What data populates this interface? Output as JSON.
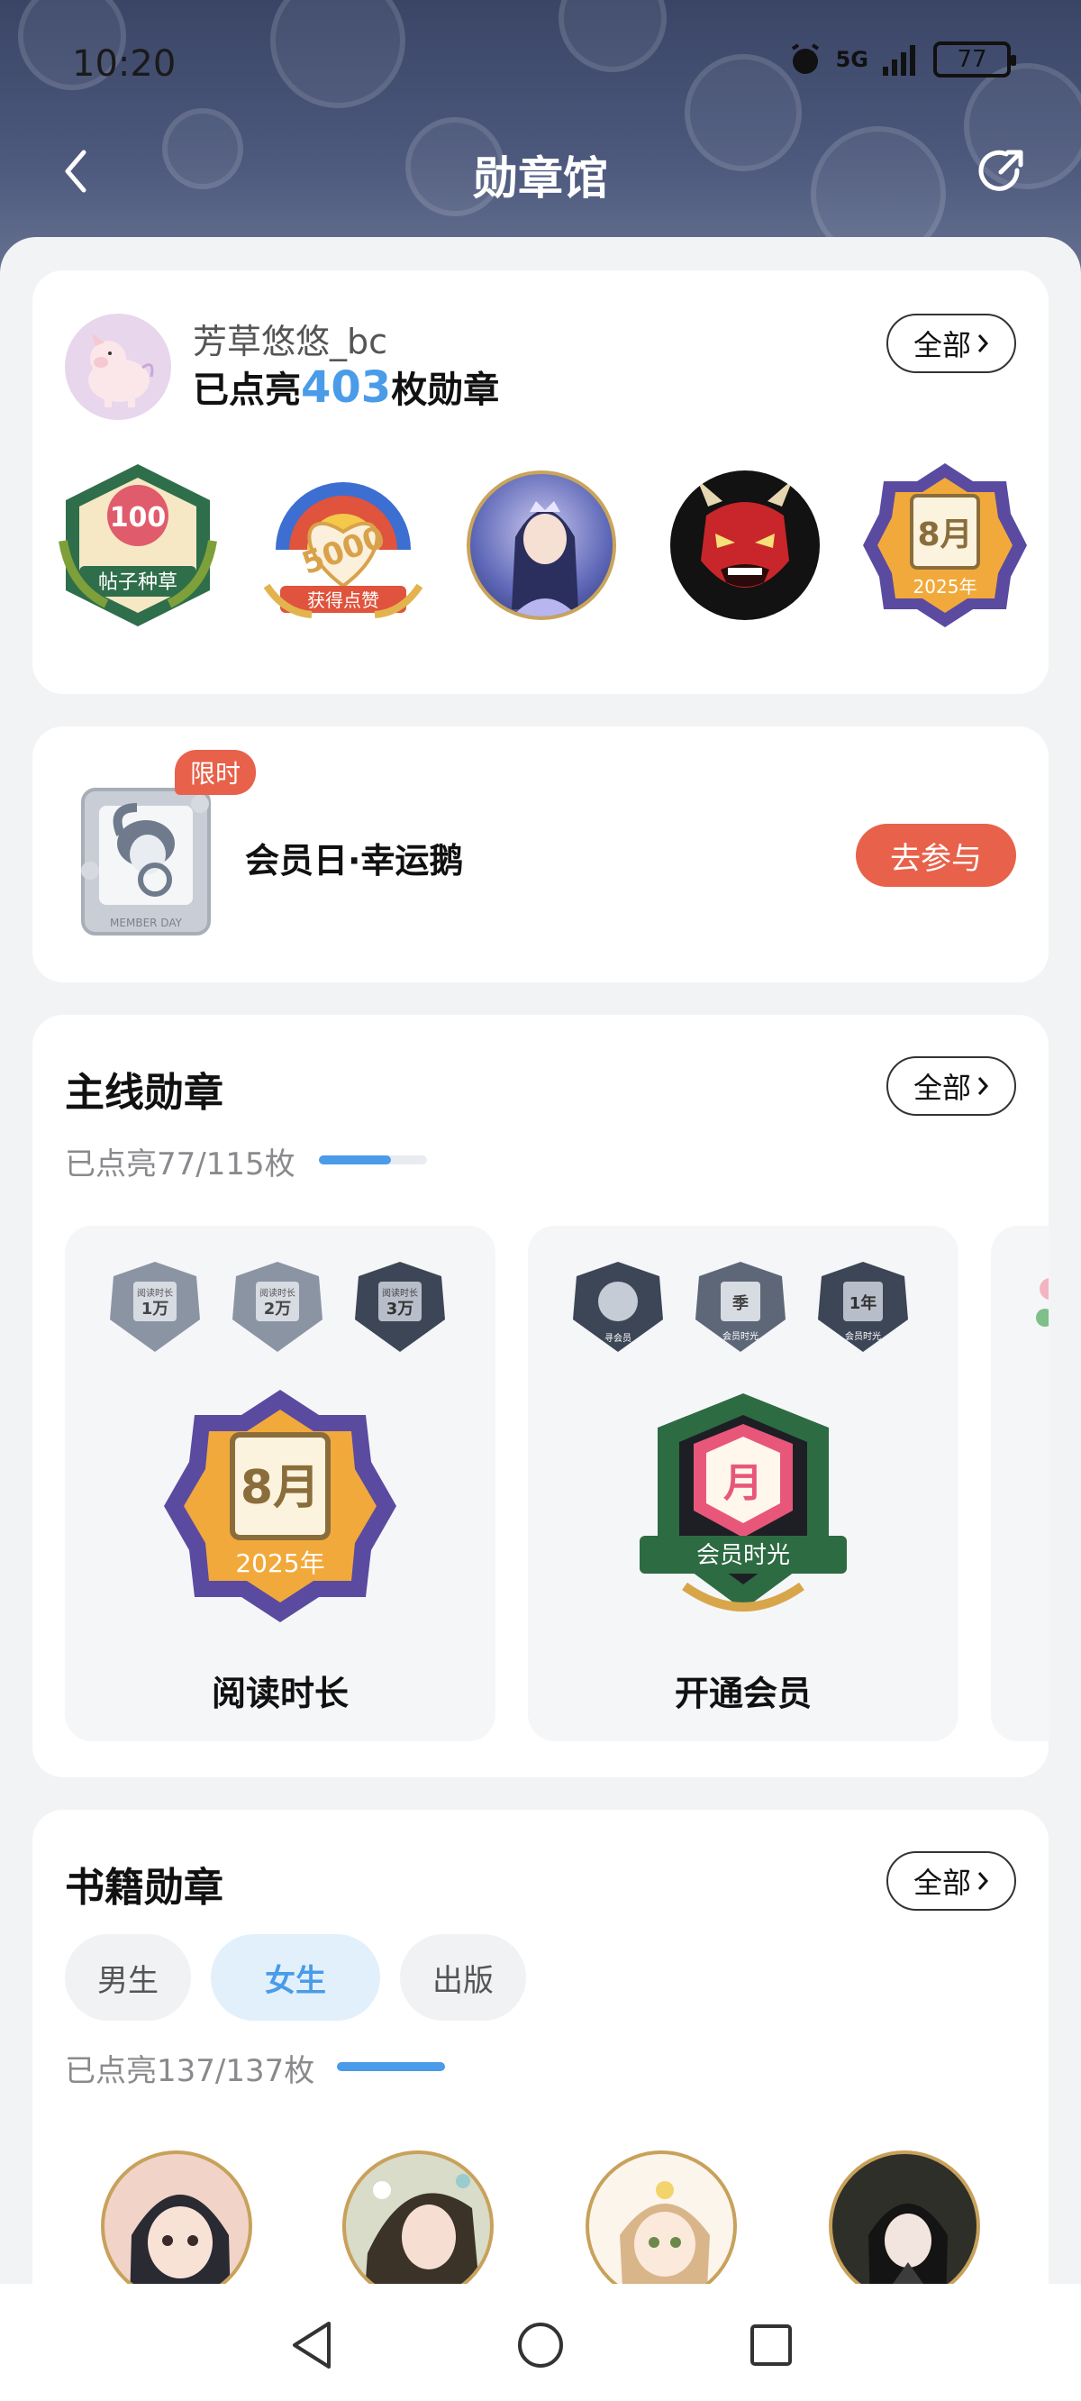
{
  "status": {
    "time": "10:20",
    "network": "5G",
    "battery": "77"
  },
  "header": {
    "title": "勋章馆"
  },
  "profile": {
    "username": "芳草悠悠_bc",
    "lit_prefix": "已点亮",
    "lit_count": "403",
    "lit_suffix": "枚勋章",
    "all_label": "全部",
    "badges": [
      {
        "name": "post-seed-badge",
        "number": "100",
        "ribbon": "帖子种草"
      },
      {
        "name": "likes-badge",
        "number": "5000",
        "ribbon": "获得点赞"
      },
      {
        "name": "princess-badge"
      },
      {
        "name": "oni-mask-badge"
      },
      {
        "name": "august-reading-badge",
        "month": "8月",
        "year": "2025年"
      }
    ]
  },
  "promo": {
    "tag": "限时",
    "title": "会员日·幸运鹅",
    "button": "去参与",
    "frame_text": "MEMBER DAY"
  },
  "main_medals": {
    "title": "主线勋章",
    "all_label": "全部",
    "progress_text": "已点亮77/115枚",
    "progress": 0.67,
    "cards": [
      {
        "label": "阅读时长",
        "mini": [
          "1万",
          "2万",
          "3万"
        ],
        "mini_caption": "阅读时长",
        "month": "8月",
        "year": "2025年"
      },
      {
        "label": "开通会员",
        "mini": [
          "",
          "季",
          "1年"
        ],
        "mini_caption": "会员时光",
        "mini_first": "寻会员",
        "month": "月",
        "ribbon": "会员时光"
      }
    ]
  },
  "book_medals": {
    "title": "书籍勋章",
    "all_label": "全部",
    "tabs": [
      "男生",
      "女生",
      "出版"
    ],
    "active_tab": 1,
    "progress_text": "已点亮137/137枚",
    "progress": 1.0
  },
  "colors": {
    "accent": "#4a9be8",
    "promo": "#e8614a",
    "tab_active_bg": "#e2f0fc",
    "tab_bg": "#f1f2f4"
  }
}
